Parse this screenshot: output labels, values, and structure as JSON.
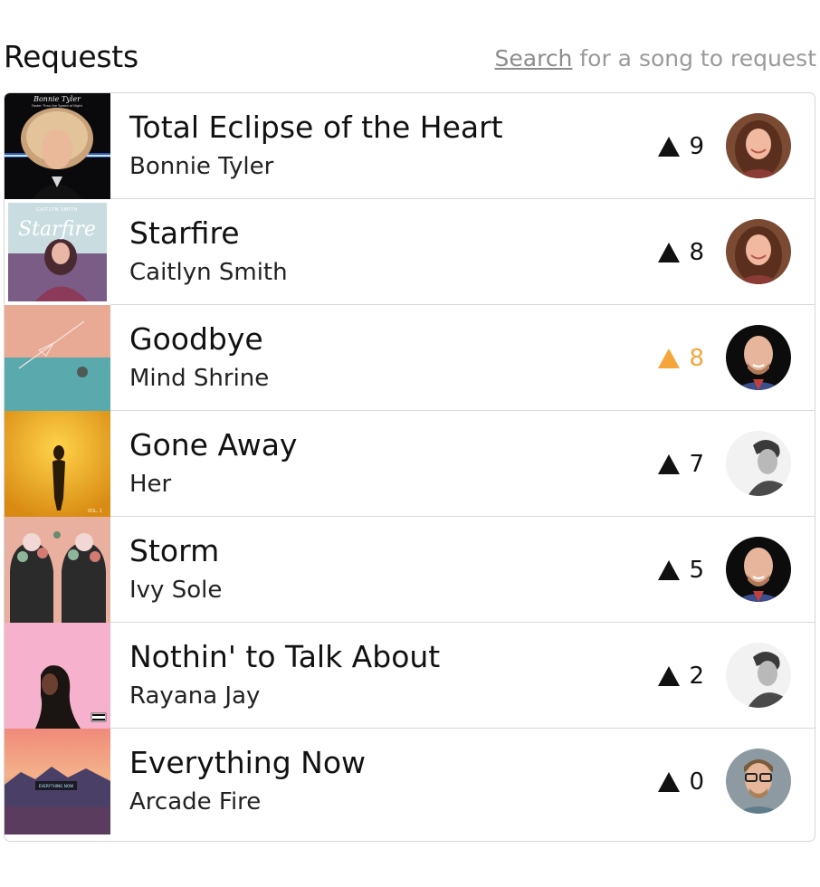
{
  "header": {
    "title": "Requests",
    "search_link": "Search",
    "search_suffix": " for a song to request"
  },
  "colors": {
    "vote_active": "#f5a53a",
    "vote_default": "#111111",
    "border": "#d6d6d6",
    "hint": "#9a9a9a"
  },
  "requests": [
    {
      "title": "Total Eclipse of the Heart",
      "artist": "Bonnie Tyler",
      "votes": "9",
      "voted": false,
      "art_icon": "album-art-total-eclipse",
      "avatar_icon": "avatar-woman-curly-hair",
      "art_text": [
        "Bonnie Tyler",
        "Faster Than the Speed of Night"
      ]
    },
    {
      "title": "Starfire",
      "artist": "Caitlyn Smith",
      "votes": "8",
      "voted": false,
      "art_icon": "album-art-starfire",
      "avatar_icon": "avatar-woman-curly-hair",
      "art_text": [
        "CAITLYN SMITH",
        "Starfire"
      ]
    },
    {
      "title": "Goodbye",
      "artist": "Mind Shrine",
      "votes": "8",
      "voted": true,
      "art_icon": "album-art-goodbye",
      "avatar_icon": "avatar-bald-man",
      "art_text": []
    },
    {
      "title": "Gone Away",
      "artist": "Her",
      "votes": "7",
      "voted": false,
      "art_icon": "album-art-gone-away",
      "avatar_icon": "avatar-man-bw",
      "art_text": [
        "VOL. 1"
      ]
    },
    {
      "title": "Storm",
      "artist": "Ivy Sole",
      "votes": "5",
      "voted": false,
      "art_icon": "album-art-storm",
      "avatar_icon": "avatar-bald-man",
      "art_text": []
    },
    {
      "title": "Nothin' to Talk About",
      "artist": "Rayana Jay",
      "votes": "2",
      "voted": false,
      "art_icon": "album-art-nothin",
      "avatar_icon": "avatar-man-bw",
      "art_text": []
    },
    {
      "title": "Everything Now",
      "artist": "Arcade Fire",
      "votes": "0",
      "voted": false,
      "art_icon": "album-art-everything-now",
      "avatar_icon": "avatar-man-glasses",
      "art_text": [
        "EVERYTHING NOW"
      ]
    }
  ]
}
